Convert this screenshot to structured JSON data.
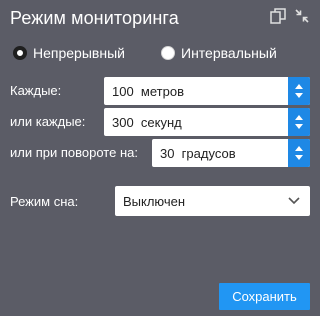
{
  "header": {
    "title": "Режим мониторинга",
    "icons": [
      "copy-icon",
      "collapse-icon"
    ]
  },
  "mode": {
    "continuous_label": "Непрерывный",
    "interval_label": "Интервальный",
    "selected": "continuous"
  },
  "fields": [
    {
      "label": "Каждые:",
      "value": "100  метров"
    },
    {
      "label": "или каждые:",
      "value": "300  секунд"
    },
    {
      "label": "или при повороте на:",
      "value": "30  градусов"
    }
  ],
  "sleep": {
    "label": "Режим сна:",
    "value": "Выключен"
  },
  "actions": {
    "save_label": "Сохранить"
  },
  "colors": {
    "background": "#5b5c66",
    "accent": "#2196f3"
  }
}
